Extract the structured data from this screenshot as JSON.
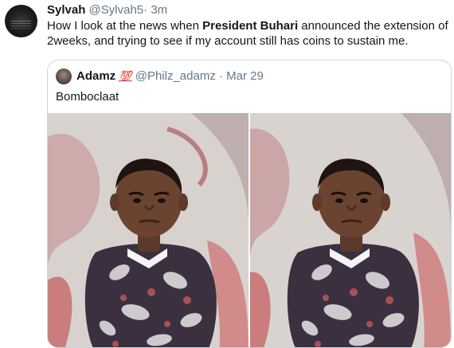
{
  "tweet": {
    "author_name": "Sylvah",
    "author_handle": "@Sylvah5",
    "separator": "·",
    "time": "3m",
    "text_before": "How I look at the news when ",
    "text_bold": "President Buhari",
    "text_after": " announced the extension of 2weeks, and trying to see if my account still has coins to sustain me."
  },
  "quoted_tweet": {
    "author_name": "Adamz",
    "badge": "💯",
    "author_handle": "@Philz_adamz",
    "separator": "·",
    "time": "Mar 29",
    "text": "Bomboclaat"
  },
  "icons": {
    "author_avatar": "avatar-image",
    "quoted_avatar": "avatar-image"
  },
  "colors": {
    "text": "#14171a",
    "secondary": "#657786",
    "border": "#ccd6dd",
    "badge": "#e0245e"
  }
}
